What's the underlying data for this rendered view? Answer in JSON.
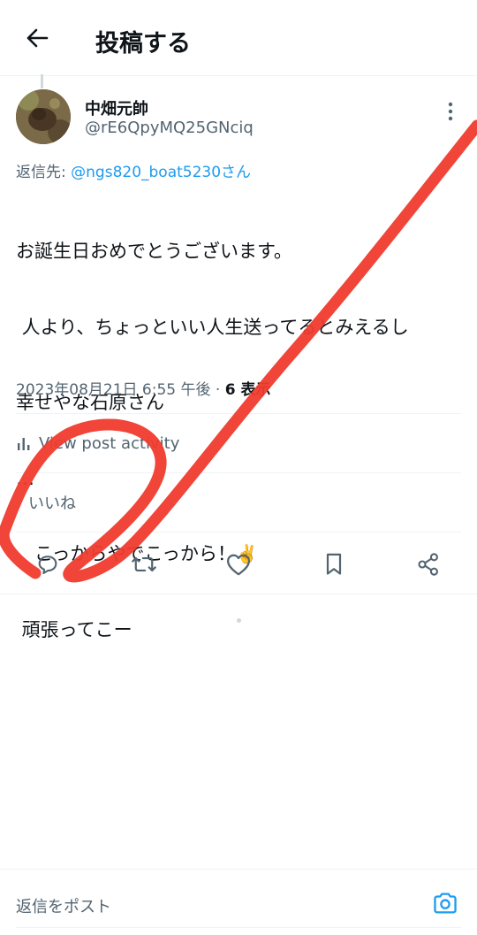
{
  "header": {
    "title": "投稿する",
    "back_icon": "arrow-left-icon"
  },
  "post": {
    "author_name": "中畑元帥",
    "author_handle": "@rE6QpyMQ25GNciq",
    "reply_to_label": "返信先: ",
    "reply_to_mention": "@ngs820_boat5230さん",
    "text_lines": [
      "お誕生日おめでとうございます。",
      " 人より、ちょっといい人生送ってるとみえるし",
      "幸せやな石原さん",
      "…",
      "　こっからやでこっから！",
      " 頑張ってこー"
    ],
    "emoji": "✌️",
    "timestamp": "2023年08月21日 6:55 午後",
    "separator": " · ",
    "views": "6 表示"
  },
  "activity_label": "View post activity",
  "likes_label": "いいね",
  "actions": {
    "reply_icon": "comment-icon",
    "repost_icon": "repost-icon",
    "like_icon": "heart-icon",
    "bookmark_icon": "bookmark-icon",
    "share_icon": "share-icon"
  },
  "reply_bar": {
    "placeholder": "返信をポスト",
    "camera_icon": "camera-icon"
  },
  "colors": {
    "accent": "#1d9bf0",
    "secondary_text": "#536471",
    "annotation": "#f03b2e"
  }
}
